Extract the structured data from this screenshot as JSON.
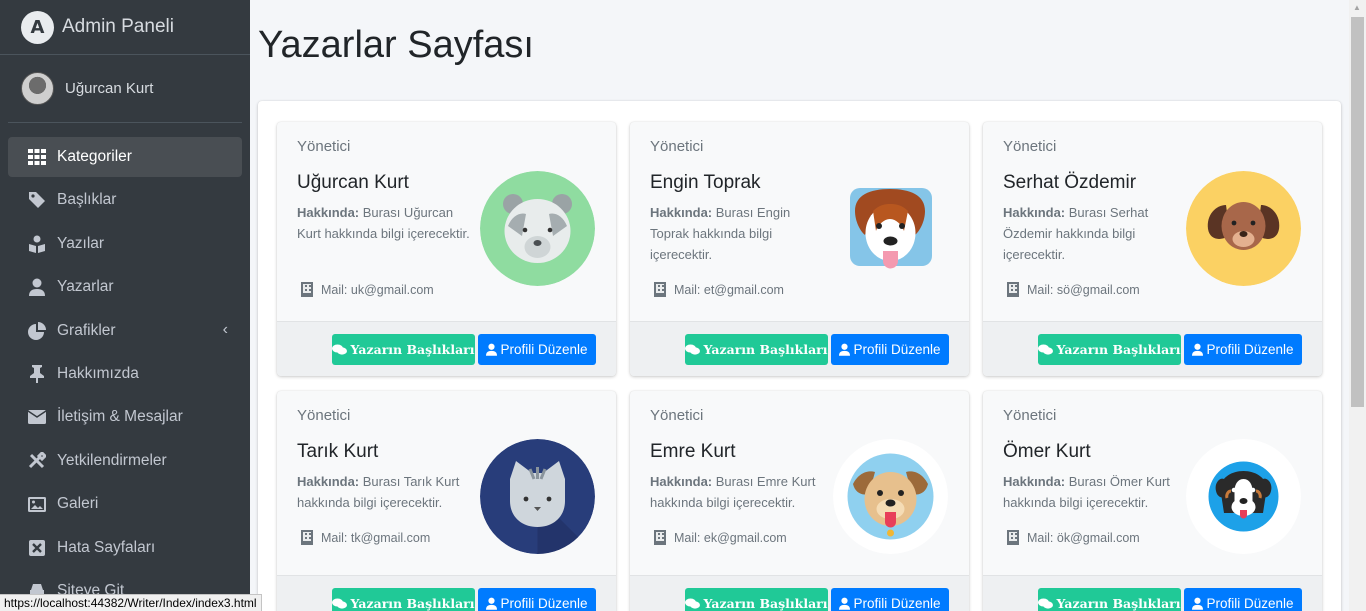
{
  "brand": {
    "title": "Admin Paneli",
    "logo_letter": "A"
  },
  "user": {
    "name": "Uğurcan Kurt"
  },
  "sidebar": {
    "items": [
      {
        "label": "Kategoriler",
        "icon": "grid-icon",
        "active": true
      },
      {
        "label": "Başlıklar",
        "icon": "tag-icon"
      },
      {
        "label": "Yazılar",
        "icon": "book-reader-icon"
      },
      {
        "label": "Yazarlar",
        "icon": "user-icon"
      },
      {
        "label": "Grafikler",
        "icon": "pie-chart-icon",
        "caret": "‹"
      },
      {
        "label": "Hakkımızda",
        "icon": "thumbtack-icon"
      },
      {
        "label": "İletişim & Mesajlar",
        "icon": "envelope-icon"
      },
      {
        "label": "Yetkilendirmeler",
        "icon": "tools-icon"
      },
      {
        "label": "Galeri",
        "icon": "image-icon"
      },
      {
        "label": "Hata Sayfaları",
        "icon": "close-box-icon"
      },
      {
        "label": "Siteye Git",
        "icon": "car-icon"
      }
    ]
  },
  "page": {
    "title": "Yazarlar Sayfası"
  },
  "writers": [
    {
      "role": "Yönetici",
      "name": "Uğurcan Kurt",
      "about_label": "Hakkında:",
      "about": " Burası Uğurcan Kurt hakkında bilgi içerecektir.",
      "mail": "Mail: uk@gmail.com",
      "avatar": "panda-avatar",
      "btn_titles": "Yazarın Başlıkları",
      "btn_edit": "Profili Düzenle"
    },
    {
      "role": "Yönetici",
      "name": "Engin Toprak",
      "about_label": "Hakkında:",
      "about": " Burası Engin Toprak hakkında bilgi içerecektir.",
      "mail": "Mail: et@gmail.com",
      "avatar": "dog-avatar",
      "btn_titles": "Yazarın Başlıkları",
      "btn_edit": "Profili Düzenle"
    },
    {
      "role": "Yönetici",
      "name": "Serhat Özdemir",
      "about_label": "Hakkında:",
      "about": " Burası Serhat Özdemir hakkında bilgi içerecektir.",
      "mail": "Mail: sö@gmail.com",
      "avatar": "puppy-avatar",
      "btn_titles": "Yazarın Başlıkları",
      "btn_edit": "Profili Düzenle"
    },
    {
      "role": "Yönetici",
      "name": "Tarık Kurt",
      "about_label": "Hakkında:",
      "about": " Burası Tarık Kurt hakkında bilgi içerecektir.",
      "mail": "Mail: tk@gmail.com",
      "avatar": "cat-avatar",
      "btn_titles": "Yazarın Başlıkları",
      "btn_edit": "Profili Düzenle"
    },
    {
      "role": "Yönetici",
      "name": "Emre Kurt",
      "about_label": "Hakkında:",
      "about": " Burası Emre Kurt hakkında bilgi içerecektir.",
      "mail": "Mail: ek@gmail.com",
      "avatar": "pug-avatar",
      "btn_titles": "Yazarın Başlıkları",
      "btn_edit": "Profili Düzenle"
    },
    {
      "role": "Yönetici",
      "name": "Ömer Kurt",
      "about_label": "Hakkında:",
      "about": " Burası Ömer Kurt hakkında bilgi içerecektir.",
      "mail": "Mail: ök@gmail.com",
      "avatar": "bernese-dog-avatar",
      "btn_titles": "Yazarın Başlıkları",
      "btn_edit": "Profili Düzenle"
    }
  ],
  "status_bar": {
    "url": "https://localhost:44382/Writer/Index/index3.html"
  },
  "colors": {
    "sidebar": "#343a40",
    "active_item": "#494e53",
    "btn_green": "#20c997",
    "btn_blue": "#007bff"
  }
}
